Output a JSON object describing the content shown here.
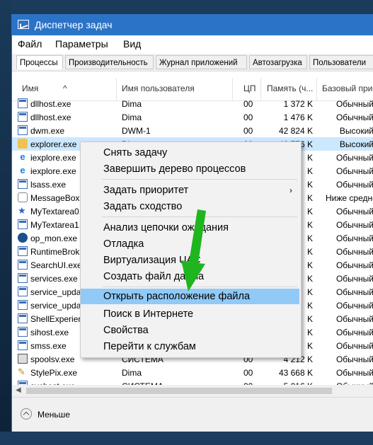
{
  "window": {
    "title": "Диспетчер задач"
  },
  "menu": {
    "items": [
      "Файл",
      "Параметры",
      "Вид"
    ]
  },
  "tabs": [
    "Процессы",
    "Производительность",
    "Журнал приложений",
    "Автозагрузка",
    "Пользователи"
  ],
  "columns": {
    "name": "Имя",
    "user": "Имя пользователя",
    "cpu": "ЦП",
    "memory": "Память (ч...",
    "priority": "Базовый прио"
  },
  "rows": [
    {
      "icon": "window-icon",
      "name": "dllhost.exe",
      "user": "Dima",
      "cpu": "00",
      "mem": "1 372 K",
      "prio": "Обычный"
    },
    {
      "icon": "window-icon",
      "name": "dllhost.exe",
      "user": "Dima",
      "cpu": "00",
      "mem": "1 476 K",
      "prio": "Обычный"
    },
    {
      "icon": "window-icon",
      "name": "dwm.exe",
      "user": "DWM-1",
      "cpu": "00",
      "mem": "42 824 K",
      "prio": "Высокий"
    },
    {
      "icon": "folder-icon",
      "name": "explorer.exe",
      "user": "Di",
      "cpu": "00",
      "mem": "43 776 K",
      "prio": "Высокий"
    },
    {
      "icon": "ie-icon",
      "name": "iexplore.exe",
      "user": "",
      "cpu": "",
      "mem": "K",
      "prio": "Обычный"
    },
    {
      "icon": "ie-icon",
      "name": "iexplore.exe",
      "user": "",
      "cpu": "",
      "mem": "K",
      "prio": "Обычный"
    },
    {
      "icon": "window-icon",
      "name": "lsass.exe",
      "user": "",
      "cpu": "",
      "mem": "K",
      "prio": "Обычный"
    },
    {
      "icon": "chat-icon",
      "name": "MessageBox.",
      "user": "",
      "cpu": "",
      "mem": "K",
      "prio": "Ниже среднего"
    },
    {
      "icon": "star-icon",
      "name": "MyTextarea0.",
      "user": "",
      "cpu": "",
      "mem": "K",
      "prio": "Обычный"
    },
    {
      "icon": "window-icon",
      "name": "MyTextarea1.",
      "user": "",
      "cpu": "",
      "mem": "K",
      "prio": "Обычный"
    },
    {
      "icon": "circle-icon",
      "name": "op_mon.exe",
      "user": "",
      "cpu": "",
      "mem": "K",
      "prio": "Обычный"
    },
    {
      "icon": "window-icon",
      "name": "RuntimeBrok",
      "user": "",
      "cpu": "",
      "mem": "K",
      "prio": "Обычный"
    },
    {
      "icon": "window-icon",
      "name": "SearchUI.exe",
      "user": "",
      "cpu": "",
      "mem": "K",
      "prio": "Обычный"
    },
    {
      "icon": "window-icon",
      "name": "services.exe",
      "user": "",
      "cpu": "",
      "mem": "K",
      "prio": "Обычный"
    },
    {
      "icon": "window-icon",
      "name": "service_upda",
      "user": "",
      "cpu": "",
      "mem": "K",
      "prio": "Обычный"
    },
    {
      "icon": "window-icon",
      "name": "service_upda",
      "user": "",
      "cpu": "",
      "mem": "K",
      "prio": "Обычный"
    },
    {
      "icon": "window-icon",
      "name": "ShellExperien",
      "user": "",
      "cpu": "",
      "mem": "K",
      "prio": "Обычный"
    },
    {
      "icon": "window-icon",
      "name": "sihost.exe",
      "user": "",
      "cpu": "",
      "mem": "K",
      "prio": "Обычный"
    },
    {
      "icon": "window-icon",
      "name": "smss.exe",
      "user": "",
      "cpu": "",
      "mem": "K",
      "prio": "Обычный"
    },
    {
      "icon": "printer-icon",
      "name": "spoolsv.exe",
      "user": "СИСТЕМА",
      "cpu": "00",
      "mem": "4 212 K",
      "prio": "Обычный"
    },
    {
      "icon": "pen-icon",
      "name": "StylePix.exe",
      "user": "Dima",
      "cpu": "00",
      "mem": "43 668 K",
      "prio": "Обычный"
    },
    {
      "icon": "window-icon",
      "name": "svchost.exe",
      "user": "СИСТЕМА",
      "cpu": "00",
      "mem": "5 016 K",
      "prio": "Обычный"
    }
  ],
  "selected_row": 3,
  "context_menu": {
    "items": [
      "Снять задачу",
      "Завершить дерево процессов",
      "Задать приоритет",
      "Задать сходство",
      "Анализ цепочки ожидания",
      "Отладка",
      "Виртуализация UAC",
      "Создать файл дампа",
      "Открыть расположение файла",
      "Поиск в Интернете",
      "Свойства",
      "Перейти к службам"
    ],
    "highlighted": 8
  },
  "footer": {
    "less_label": "Меньше"
  },
  "colors": {
    "titlebar": "#2b73c7",
    "selection": "#cce8ff",
    "menu_highlight": "#91c9f7",
    "arrow": "#1fb51f"
  }
}
